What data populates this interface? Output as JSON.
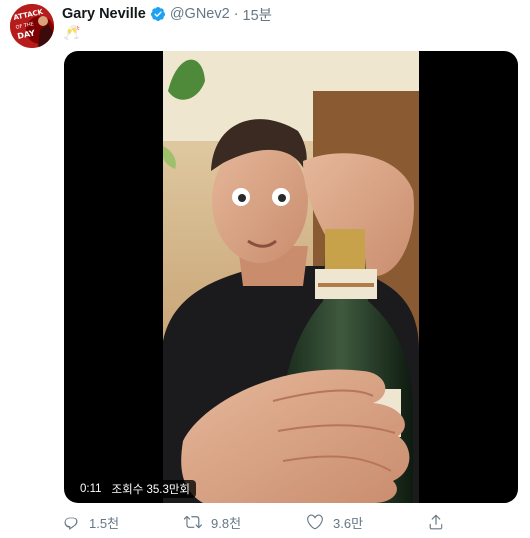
{
  "tweet": {
    "author_name": "Gary Neville",
    "handle": "@GNev2",
    "separator": "·",
    "time": "15분",
    "text": "🥂",
    "avatar_text": "ATTACK OF THE DAY",
    "video": {
      "duration": "0:11",
      "views": "조회수 35.3만회"
    },
    "actions": {
      "replies": "1.5천",
      "retweets": "9.8천",
      "likes": "3.6만"
    }
  },
  "colors": {
    "verified": "#1da1f2",
    "secondary_text": "#657786",
    "primary_text": "#14171a",
    "avatar_bg": "#b71c1c"
  },
  "icons": [
    "verified-badge-icon",
    "reply-icon",
    "retweet-icon",
    "like-icon",
    "share-icon"
  ]
}
